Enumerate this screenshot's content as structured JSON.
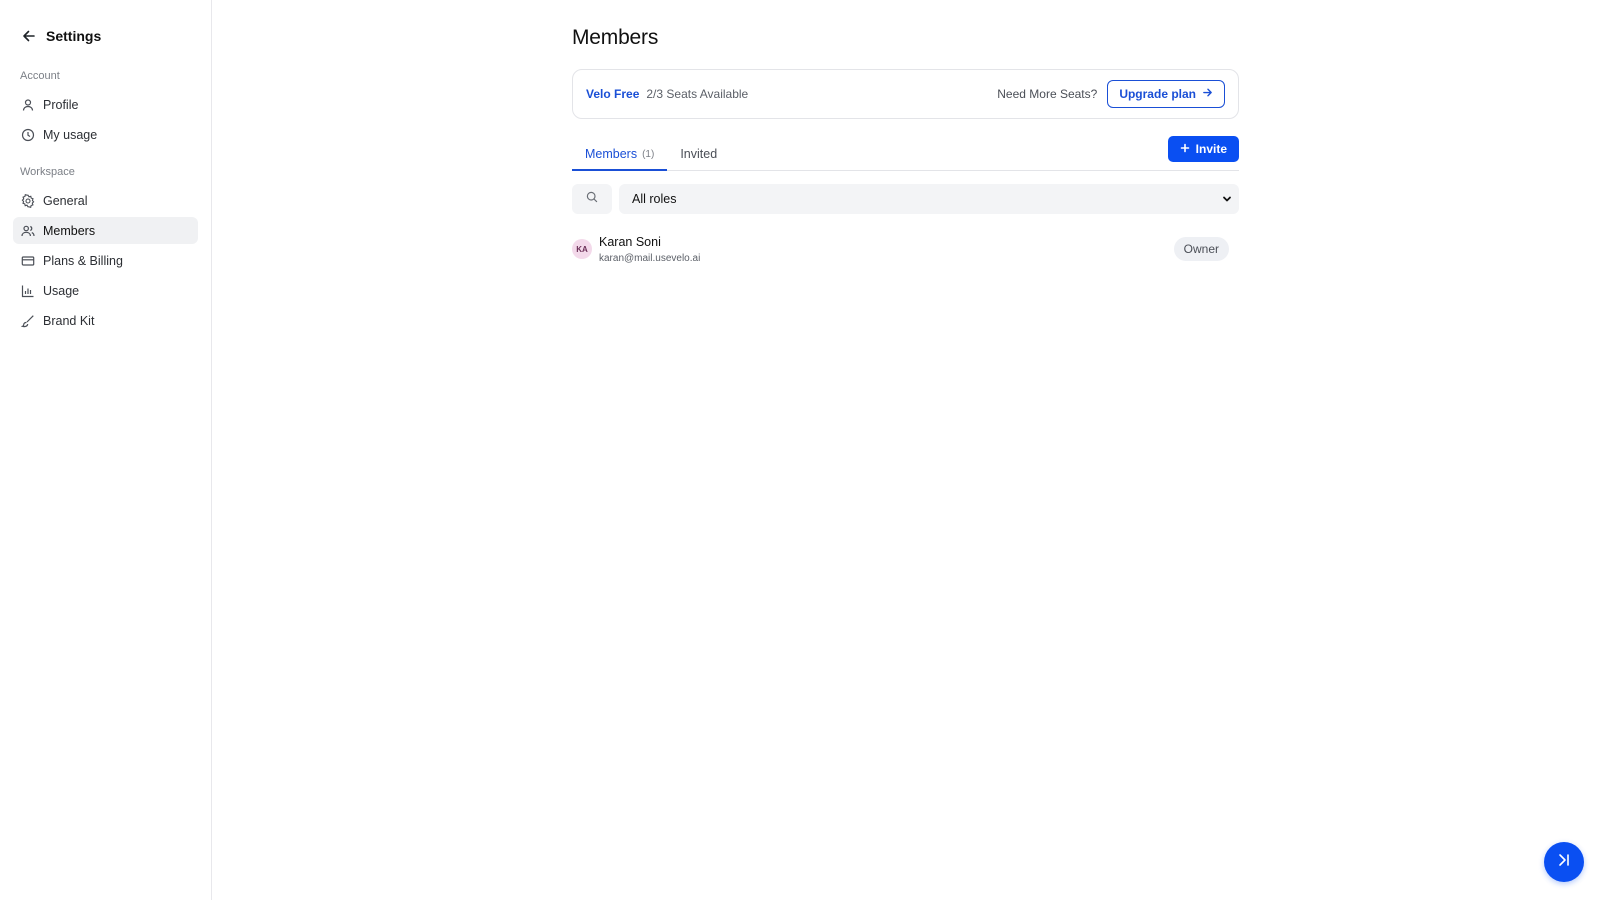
{
  "sidebar": {
    "title": "Settings",
    "sections": [
      {
        "label": "Account",
        "items": [
          {
            "label": "Profile",
            "icon": "user-icon",
            "active": false
          },
          {
            "label": "My usage",
            "icon": "clock-icon",
            "active": false
          }
        ]
      },
      {
        "label": "Workspace",
        "items": [
          {
            "label": "General",
            "icon": "gear-icon",
            "active": false
          },
          {
            "label": "Members",
            "icon": "users-icon",
            "active": true
          },
          {
            "label": "Plans & Billing",
            "icon": "credit-card-icon",
            "active": false
          },
          {
            "label": "Usage",
            "icon": "bar-chart-icon",
            "active": false
          },
          {
            "label": "Brand Kit",
            "icon": "brush-icon",
            "active": false
          }
        ]
      }
    ]
  },
  "main": {
    "title": "Members",
    "plan": {
      "name": "Velo Free",
      "seats": "2/3 Seats Available",
      "need_more": "Need More Seats?",
      "upgrade_label": "Upgrade plan"
    },
    "tabs": [
      {
        "label": "Members",
        "count": "(1)",
        "active": true
      },
      {
        "label": "Invited",
        "count": "",
        "active": false
      }
    ],
    "invite_label": "Invite",
    "filter": {
      "role_value": "All roles"
    },
    "members": [
      {
        "initials": "KA",
        "name": "Karan Soni",
        "email": "karan@mail.usevelo.ai",
        "role": "Owner"
      }
    ]
  },
  "colors": {
    "accent": "#0a4ff2",
    "link": "#1a4fd6",
    "active_nav_bg": "#f0f1f3"
  }
}
